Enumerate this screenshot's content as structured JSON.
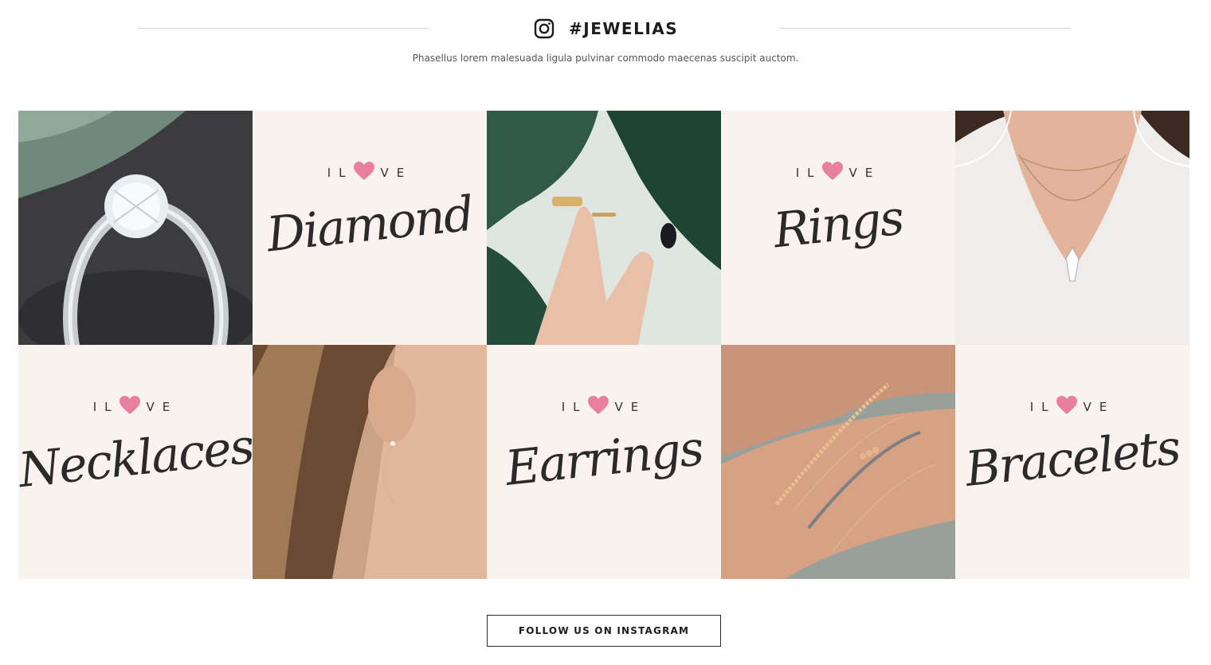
{
  "header": {
    "hashtag": "#JEWELIAS",
    "subtitle": "Phasellus lorem malesuada ligula pulvinar commodo maecenas suscipit auctom."
  },
  "love_prefix": [
    "I",
    "L",
    "V",
    "E"
  ],
  "tiles": {
    "diamond": "Diamond",
    "rings": "Rings",
    "necklaces": "Necklaces",
    "earrings": "Earrings",
    "bracelets": "Bracelets"
  },
  "icons": {
    "instagram": "instagram-icon",
    "heart": "heart-icon"
  },
  "colors": {
    "heart": "#e97fa0",
    "tile_bg": "#f9f2ee",
    "text_dark": "#1c1c1c"
  },
  "cta": {
    "follow_label": "FOLLOW US ON INSTAGRAM"
  }
}
